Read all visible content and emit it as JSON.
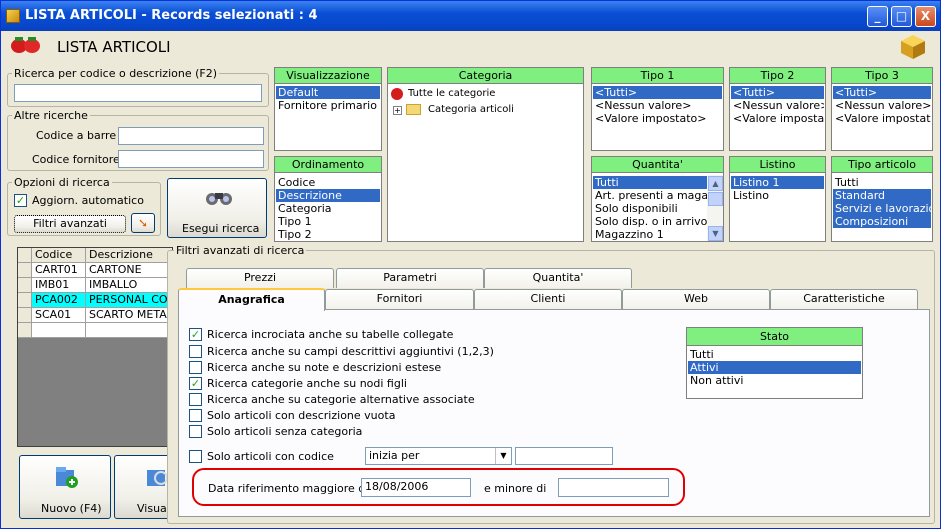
{
  "window": {
    "title": "LISTA ARTICOLI - Records selezionati : 4",
    "min": "_",
    "max": "□",
    "close": "X"
  },
  "header": {
    "title": "LISTA ARTICOLI"
  },
  "search": {
    "group_label": "Ricerca per codice o descrizione (F2)",
    "value": ""
  },
  "other": {
    "group_label": "Altre ricerche",
    "barcode_label": "Codice a barre :",
    "supplier_code_label": "Codice fornitore :"
  },
  "options": {
    "group_label": "Opzioni di ricerca",
    "auto_label": "Aggiorn. automatico",
    "auto_checked": true,
    "advanced_button": "Filtri avanzati"
  },
  "exec": {
    "label": "Esegui ricerca"
  },
  "panels": {
    "visualizzazione": {
      "header": "Visualizzazione",
      "items": [
        "Default",
        "Fornitore primario"
      ],
      "selected": 0
    },
    "ordinamento": {
      "header": "Ordinamento",
      "items": [
        "Codice",
        "Descrizione",
        "Categoria",
        "Tipo 1",
        "Tipo 2"
      ],
      "selected": 1
    },
    "categoria": {
      "header": "Categoria",
      "root": "Tutte le categorie",
      "child": "Categoria articoli"
    },
    "tipo1": {
      "header": "Tipo 1",
      "items": [
        "<Tutti>",
        "<Nessun valore>",
        "<Valore impostato>"
      ],
      "selected": 0
    },
    "tipo2": {
      "header": "Tipo 2",
      "items": [
        "<Tutti>",
        "<Nessun valore>",
        "<Valore impostato>"
      ],
      "selected": 0
    },
    "tipo3": {
      "header": "Tipo 3",
      "items": [
        "<Tutti>",
        "<Nessun valore>",
        "<Valore impostato>"
      ],
      "selected": 0
    },
    "quantita": {
      "header": "Quantita'",
      "items": [
        "Tutti",
        "Art. presenti a magazzino",
        "Solo disponibili",
        "Solo disp. o in arrivo",
        "Magazzino 1"
      ],
      "selected": 0
    },
    "listino": {
      "header": "Listino",
      "items": [
        "Listino 1",
        "Listino"
      ],
      "selected": 0
    },
    "tipo_articolo": {
      "header": "Tipo articolo",
      "items": [
        "Tutti",
        "Standard",
        "Servizi e lavorazioni",
        "Composizioni"
      ],
      "selected_from": 1
    }
  },
  "grid": {
    "headers": [
      "Codice",
      "Descrizione"
    ],
    "rows": [
      {
        "codice": "CART01",
        "descrizione": "CARTONE"
      },
      {
        "codice": "IMB01",
        "descrizione": "IMBALLO"
      },
      {
        "codice": "PCA002",
        "descrizione": "PERSONAL COMPUTER"
      },
      {
        "codice": "SCA01",
        "descrizione": "SCARTO METALLO"
      }
    ],
    "selected_row": 2
  },
  "bottom": {
    "new_label": "Nuovo (F4)",
    "view_label": "Visualizza"
  },
  "filters": {
    "group_label": "Filtri avanzati di ricerca",
    "tabs_back": [
      "Prezzi",
      "Parametri",
      "Quantita'"
    ],
    "tabs_front": [
      "Anagrafica",
      "Fornitori",
      "Clienti",
      "Web",
      "Caratteristiche"
    ],
    "active_tab": "Anagrafica",
    "checks": [
      {
        "label": "Ricerca incrociata anche su tabelle collegate",
        "checked": true
      },
      {
        "label": "Ricerca anche su campi descrittivi aggiuntivi (1,2,3)",
        "checked": false
      },
      {
        "label": "Ricerca anche su note e descrizioni estese",
        "checked": false
      },
      {
        "label": "Ricerca categorie anche su nodi figli",
        "checked": true
      },
      {
        "label": "Ricerca anche su categorie alternative associate",
        "checked": false
      },
      {
        "label": "Solo articoli con descrizione vuota",
        "checked": false
      },
      {
        "label": "Solo articoli senza categoria",
        "checked": false
      }
    ],
    "code_check_label": "Solo articoli con codice",
    "code_mode": "inizia per",
    "date_label": "Data riferimento maggiore di",
    "date_value": "18/08/2006",
    "date_less_label": "e minore di",
    "date_less_value": "",
    "stato": {
      "header": "Stato",
      "items": [
        "Tutti",
        "Attivi",
        "Non attivi"
      ],
      "selected": 1
    }
  },
  "colors": {
    "highlight": "#316ac5",
    "header_green": "#7ff07f",
    "grid_selected": "#00ffff",
    "date_outline": "#e00000"
  }
}
